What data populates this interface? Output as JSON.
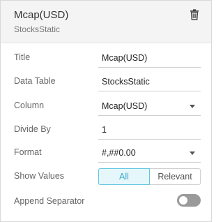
{
  "header": {
    "title": "Mcap(USD)",
    "subtitle": "StocksStatic",
    "delete_icon": "trash-icon"
  },
  "fields": {
    "title": {
      "label": "Title",
      "value": "Mcap(USD)"
    },
    "data_table": {
      "label": "Data Table",
      "value": "StocksStatic"
    },
    "column": {
      "label": "Column",
      "value": "Mcap(USD)"
    },
    "divide_by": {
      "label": "Divide By",
      "value": "1"
    },
    "format": {
      "label": "Format",
      "value": "#,##0.00"
    },
    "show_values": {
      "label": "Show Values",
      "options": [
        "All",
        "Relevant"
      ],
      "selected": "All"
    },
    "append_separator": {
      "label": "Append Separator",
      "enabled": false
    }
  },
  "colors": {
    "accent": "#3aa9c9",
    "accent_bg": "#e6f7fb",
    "toggle_off": "#9a9a9a",
    "header_bg": "#f4f4f4"
  }
}
